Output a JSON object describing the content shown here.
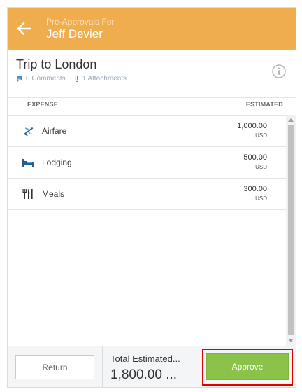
{
  "header": {
    "subtitle": "Pre-Approvals For",
    "name": "Jeff Devier",
    "color": "#f0ad4e"
  },
  "trip": {
    "title": "Trip to London",
    "comments": "0 Comments",
    "attachments": "1 Attachments"
  },
  "columns": {
    "expense": "EXPENSE",
    "estimated": "ESTIMATED"
  },
  "expenses": [
    {
      "icon": "airplane-icon",
      "label": "Airfare",
      "amount": "1,000.00",
      "currency": "USD"
    },
    {
      "icon": "bed-icon",
      "label": "Lodging",
      "amount": "500.00",
      "currency": "USD"
    },
    {
      "icon": "fork-knife-icon",
      "label": "Meals",
      "amount": "300.00",
      "currency": "USD"
    }
  ],
  "footer": {
    "return_label": "Return",
    "total_label": "Total Estimated...",
    "total_value": "1,800.00 ...",
    "approve_label": "Approve",
    "approve_color": "#8bc34a",
    "highlight_color": "#e00000"
  }
}
